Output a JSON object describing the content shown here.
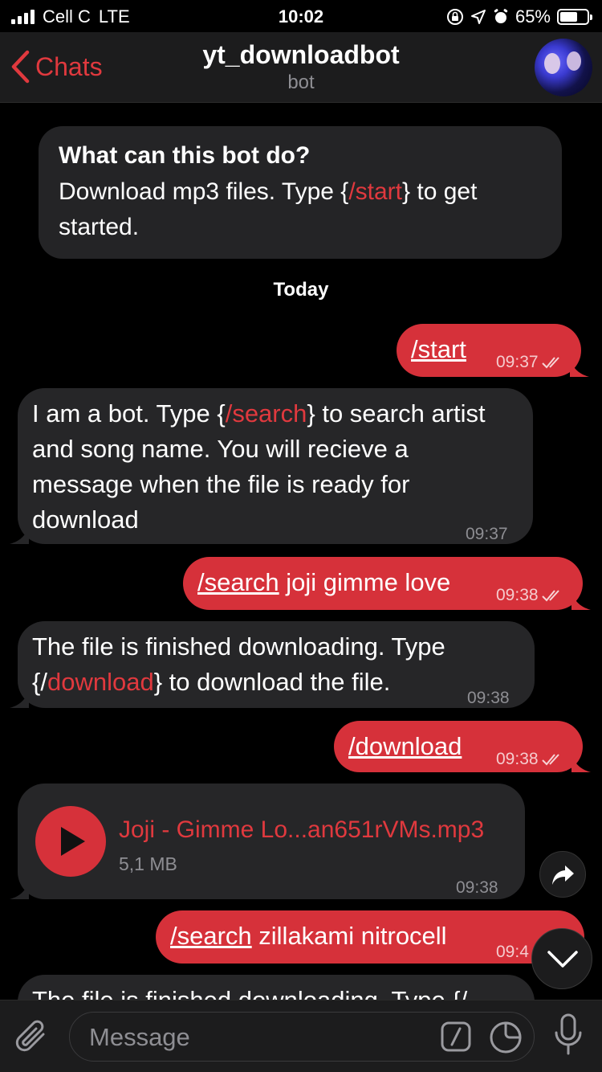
{
  "status": {
    "carrier": "Cell C",
    "network": "LTE",
    "time": "10:02",
    "battery": "65%",
    "battery_level": 0.65
  },
  "header": {
    "back_label": "Chats",
    "title": "yt_downloadbot",
    "subtitle": "bot"
  },
  "info_card": {
    "title": "What can this bot do?",
    "text_before": "Download mp3 files. Type {",
    "command": "/start",
    "text_after": "} to get started."
  },
  "date_label": "Today",
  "messages": [
    {
      "dir": "out",
      "command": "/start",
      "text": "",
      "time": "09:37"
    },
    {
      "dir": "in",
      "part1": "I am a bot. Type {",
      "command": "/search",
      "part2": "} to search artist and song name. You will recieve a message when the file is ready for download",
      "time": "09:37"
    },
    {
      "dir": "out",
      "command": "/search",
      "text": " joji gimme love",
      "time": "09:38"
    },
    {
      "dir": "in",
      "part1": "The file is finished downloading. Type {/",
      "command": "download",
      "part2": "} to download the file.",
      "time": "09:38"
    },
    {
      "dir": "out",
      "command": "/download",
      "text": "",
      "time": "09:38"
    },
    {
      "dir": "in",
      "type": "audio",
      "file_name": "Joji - Gimme Lo...an651rVMs.mp3",
      "file_size": "5,1 MB",
      "time": "09:38"
    },
    {
      "dir": "out",
      "command": "/search",
      "text": " zillakami nitrocell",
      "time": "09:4"
    },
    {
      "dir": "in",
      "part1": "The file is finished downloading. Type {/"
    }
  ],
  "input": {
    "placeholder": "Message"
  },
  "icons": {
    "back": "chevron-left-icon",
    "attach": "paperclip-icon",
    "command": "slash-command-icon",
    "sticker": "sticker-icon",
    "mic": "microphone-icon",
    "share": "share-arrow-icon",
    "scroll": "chevron-down-icon",
    "read": "double-check-icon"
  },
  "colors": {
    "accent": "#e0393e",
    "outgoing_bubble": "#d6313a",
    "incoming_bubble": "#262628",
    "background": "#000000"
  }
}
